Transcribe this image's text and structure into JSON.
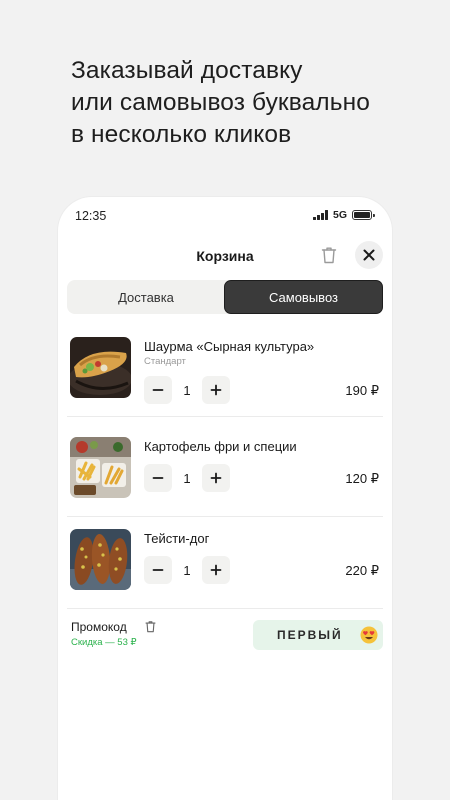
{
  "headline": {
    "line1": "Заказывай доставку",
    "line2": "или самовывоз буквально",
    "line3": "в несколько кликов"
  },
  "status_bar": {
    "time": "12:35",
    "network": "5G",
    "battery_level": 1.0
  },
  "cart": {
    "title": "Корзина"
  },
  "tabs": [
    {
      "label": "Доставка",
      "selected": false
    },
    {
      "label": "Самовывоз",
      "selected": true
    }
  ],
  "items": [
    {
      "name": "Шаурма «Сырная культура»",
      "variant": "Стандарт",
      "quantity": "1",
      "price": "190 ₽",
      "image": "shawarma-photo"
    },
    {
      "name": "Картофель фри и специи",
      "variant": "",
      "quantity": "1",
      "price": "120 ₽",
      "image": "fries-photo"
    },
    {
      "name": "Тейсти-дог",
      "variant": "",
      "quantity": "1",
      "price": "220 ₽",
      "image": "hotdog-photo"
    }
  ],
  "promo": {
    "label": "Промокод",
    "discount": "Скидка — 53 ₽",
    "code": "ПЕРВЫЙ",
    "emoji": "heart-eyes-emoji"
  },
  "colors": {
    "accent_dark": "#3a3a3a",
    "promo_bg": "#e6f4ea",
    "discount_green": "#2bb24c"
  }
}
